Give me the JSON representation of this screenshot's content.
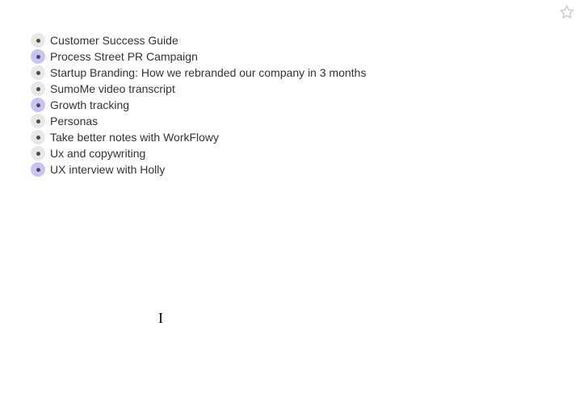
{
  "items": [
    {
      "label": "Customer Success Guide",
      "shared": false
    },
    {
      "label": "Process Street PR Campaign",
      "shared": true
    },
    {
      "label": "Startup Branding: How we rebranded our company in 3 months",
      "shared": false
    },
    {
      "label": "SumoMe video transcript",
      "shared": false
    },
    {
      "label": "Growth tracking",
      "shared": true
    },
    {
      "label": "Personas",
      "shared": false
    },
    {
      "label": "Take better notes with WorkFlowy",
      "shared": false
    },
    {
      "label": "Ux and copywriting",
      "shared": false
    },
    {
      "label": "UX interview with Holly",
      "shared": true
    }
  ]
}
